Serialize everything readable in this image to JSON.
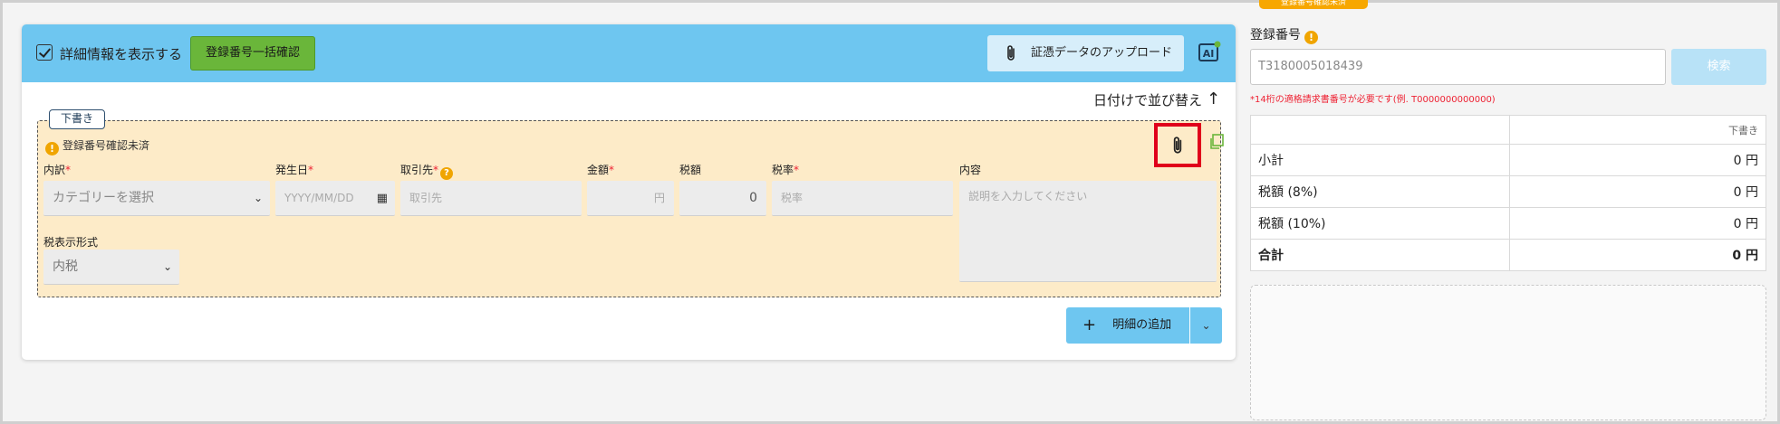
{
  "header": {
    "show_details_label": "詳細情報を表示する",
    "bulk_check_label": "登録番号一括確認",
    "upload_label": "証憑データのアップロード",
    "ai_label": "AI"
  },
  "sort": {
    "label": "日付けで並び替え",
    "arrow": "↑"
  },
  "item": {
    "badge": "下書き",
    "status": "登録番号確認未済",
    "fields": {
      "category": {
        "label": "内訳",
        "placeholder": "カテゴリーを選択"
      },
      "date": {
        "label": "発生日",
        "placeholder": "YYYY/MM/DD"
      },
      "partner": {
        "label": "取引先",
        "placeholder": "取引先"
      },
      "amount": {
        "label": "金額",
        "placeholder": "円"
      },
      "tax": {
        "label": "税額",
        "value": "0"
      },
      "tax_rate": {
        "label": "税率",
        "placeholder": "税率"
      },
      "content": {
        "label": "内容",
        "placeholder": "説明を入力してください"
      },
      "tax_display": {
        "label": "税表示形式",
        "value": "内税"
      }
    }
  },
  "add_button": {
    "label": "明細の追加"
  },
  "right_panel": {
    "tooltip": "登録番号確認未済",
    "reg_label": "登録番号",
    "reg_value": "T3180005018439",
    "search_label": "検索",
    "hint": "*14桁の適格請求書番号が必要です(例. T0000000000000)",
    "summary": {
      "header": "下書き",
      "rows": [
        {
          "label": "小計",
          "value": "0 円"
        },
        {
          "label": "税額 (8%)",
          "value": "0 円"
        },
        {
          "label": "税額 (10%)",
          "value": "0 円"
        },
        {
          "label": "合計",
          "value": "0 円"
        }
      ]
    }
  }
}
